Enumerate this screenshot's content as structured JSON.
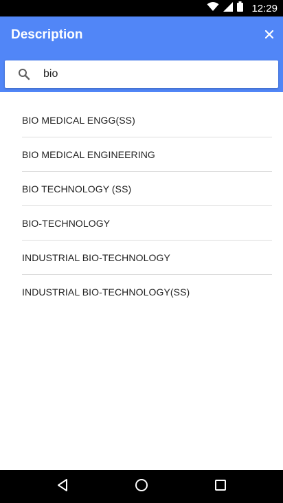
{
  "status_bar": {
    "time": "12:29",
    "icons": [
      "wifi-icon",
      "signal-icon",
      "battery-icon"
    ]
  },
  "header": {
    "title": "Description",
    "close_icon": "close-icon",
    "background_color": "#5186f7"
  },
  "search": {
    "icon": "search-icon",
    "value": "bio",
    "placeholder": ""
  },
  "results": [
    {
      "label": "BIO MEDICAL ENGG(SS)"
    },
    {
      "label": "BIO MEDICAL ENGINEERING"
    },
    {
      "label": "BIO TECHNOLOGY (SS)"
    },
    {
      "label": "BIO-TECHNOLOGY"
    },
    {
      "label": "INDUSTRIAL BIO-TECHNOLOGY"
    },
    {
      "label": "INDUSTRIAL BIO-TECHNOLOGY(SS)"
    }
  ],
  "nav_bar": {
    "buttons": [
      "back-icon",
      "home-icon",
      "recents-icon"
    ]
  }
}
